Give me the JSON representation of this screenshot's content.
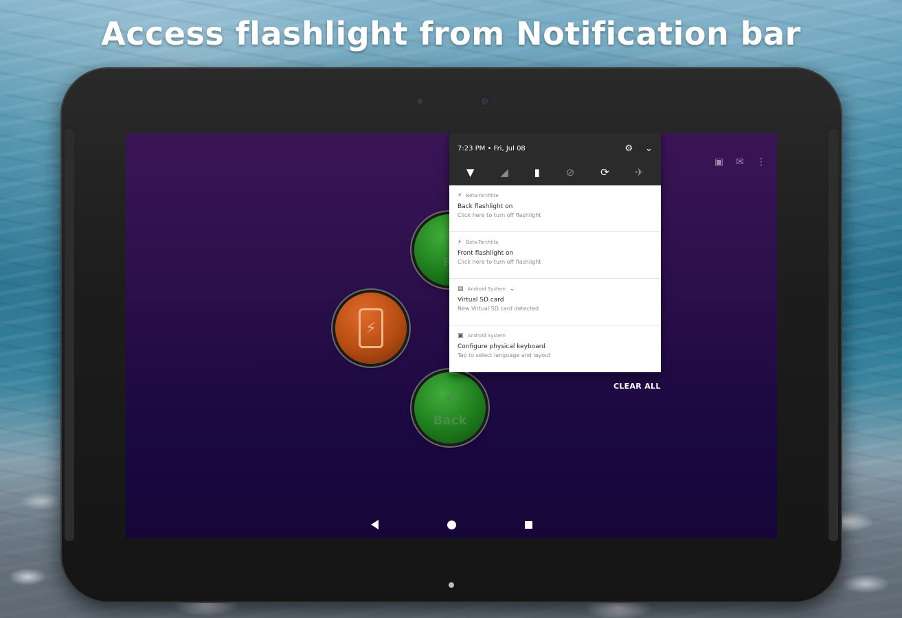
{
  "headline": "Access flashlight from Notification bar",
  "status_bar": {
    "time_date": "7:23 PM • Fri, Jul 08",
    "icons": [
      "settings-icon",
      "chevron-down-icon"
    ]
  },
  "quick_settings": [
    "wifi-icon",
    "cellular-icon",
    "battery-icon",
    "do-not-disturb-icon",
    "auto-rotate-icon",
    "airplane-mode-icon"
  ],
  "notifications": [
    {
      "app": "Beta-Torchlite",
      "title": "Back flashlight on",
      "body": "Click here to turn off flashlight",
      "icon": "bolt-icon"
    },
    {
      "app": "Beta-Torchlite",
      "title": "Front flashlight on",
      "body": "Click here to turn off flashlight",
      "icon": "bolt-icon"
    },
    {
      "app": "Android System",
      "title": "Virtual SD card",
      "body": "New Virtual SD card detected",
      "icon": "sd-card-icon"
    },
    {
      "app": "Android System",
      "title": "Configure physical keyboard",
      "body": "Tap to select language and layout",
      "icon": "keyboard-icon"
    }
  ],
  "clear_all": "CLEAR ALL",
  "app": {
    "front_label": "Fr",
    "back_label": "Back",
    "actions": [
      "feedback-icon",
      "mail-icon",
      "more-vert-icon"
    ]
  },
  "colors": {
    "screen_bg": "#2a0f4a",
    "green_button": "#1f7d1d",
    "orange_button": "#b54d12",
    "shade_bg": "#2b2b2b"
  }
}
